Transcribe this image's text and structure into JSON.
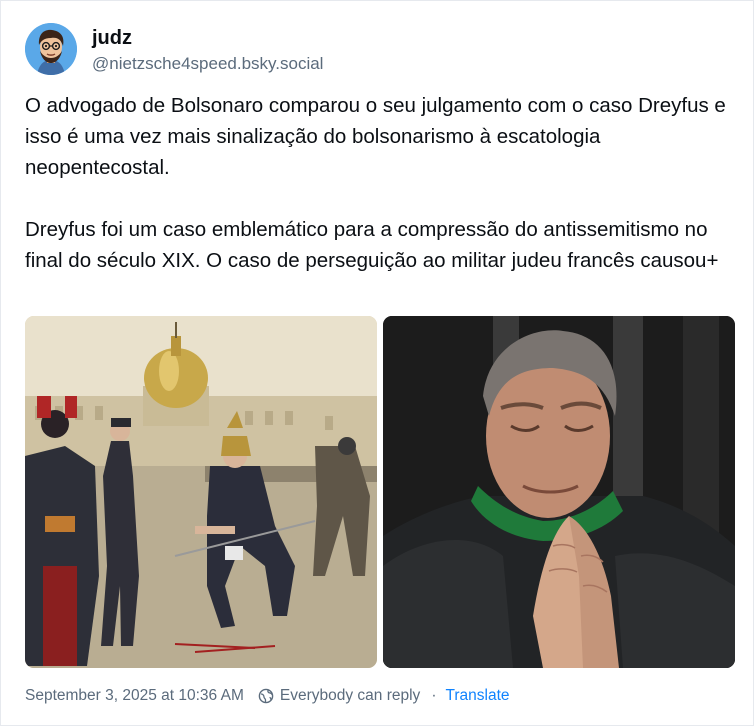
{
  "author": {
    "display_name": "judz",
    "handle": "@nietzsche4speed.bsky.social",
    "avatar_icon": "cartoon-avatar"
  },
  "post": {
    "paragraphs": [
      "O advogado de Bolsonaro comparou o seu julgamento com o caso Dreyfus e isso é uma vez mais sinalização do bolsonarismo à escatologia neopentecostal.",
      "Dreyfus foi um caso emblemático para a compressão do antissemitismo no final do século XIX. O caso de perseguição ao militar judeu francês causou+"
    ],
    "images": [
      {
        "subject": "illustration-dreyfus-degradation"
      },
      {
        "subject": "photo-man-praying"
      }
    ]
  },
  "footer": {
    "timestamp": "September 3, 2025 at 10:36 AM",
    "reply_setting_icon": "globe-icon",
    "reply_setting": "Everybody can reply",
    "separator": "·",
    "translate_label": "Translate"
  },
  "colors": {
    "text": "#0b0f14",
    "muted": "#5b6b7c",
    "link": "#1083fe",
    "border": "#e6e9ee"
  }
}
